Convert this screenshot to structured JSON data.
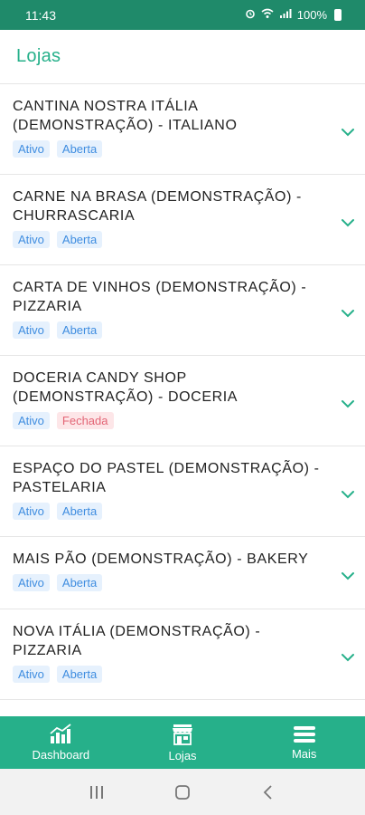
{
  "status_bar": {
    "time": "11:43",
    "battery": "100%"
  },
  "header": {
    "title": "Lojas"
  },
  "stores": [
    {
      "name": "CANTINA NOSTRA ITÁLIA (DEMONSTRAÇÃO) - ITALIANO",
      "status": "Ativo",
      "open_state": "Aberta"
    },
    {
      "name": "CARNE NA BRASA (DEMONSTRAÇÃO) - CHURRASCARIA",
      "status": "Ativo",
      "open_state": "Aberta"
    },
    {
      "name": "CARTA DE VINHOS (DEMONSTRAÇÃO) - PIZZARIA",
      "status": "Ativo",
      "open_state": "Aberta"
    },
    {
      "name": "DOCERIA CANDY SHOP (DEMONSTRAÇÃO) - DOCERIA",
      "status": "Ativo",
      "open_state": "Fechada"
    },
    {
      "name": "ESPAÇO DO PASTEL (DEMONSTRAÇÃO) - PASTELARIA",
      "status": "Ativo",
      "open_state": "Aberta"
    },
    {
      "name": "MAIS PÃO (DEMONSTRAÇÃO) - BAKERY",
      "status": "Ativo",
      "open_state": "Aberta"
    },
    {
      "name": "NOVA ITÁLIA (DEMONSTRAÇÃO) - PIZZARIA",
      "status": "Ativo",
      "open_state": "Aberta"
    }
  ],
  "tabbar": {
    "dashboard": "Dashboard",
    "lojas": "Lojas",
    "mais": "Mais"
  },
  "colors": {
    "primary": "#26b08a",
    "status_bar": "#1f8a6a",
    "tag_blue": "#3f8de0",
    "tag_red": "#e36676"
  }
}
